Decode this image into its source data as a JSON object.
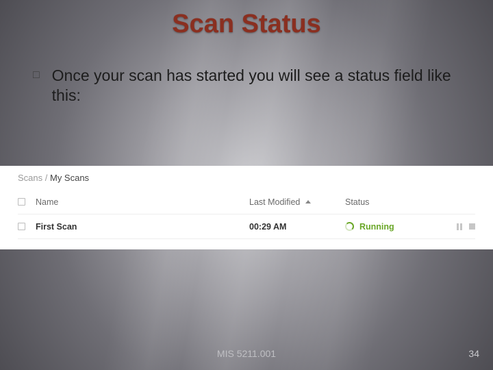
{
  "title": "Scan Status",
  "bullet": {
    "marker": "□",
    "text": "Once your scan has started you will see a status field like this:"
  },
  "panel": {
    "breadcrumb": {
      "root": "Scans",
      "sep": " / ",
      "current": "My Scans"
    },
    "headers": {
      "name": "Name",
      "last_modified": "Last Modified",
      "status": "Status"
    },
    "row": {
      "name": "First Scan",
      "last_modified": "00:29 AM",
      "status": "Running"
    }
  },
  "footer": {
    "course": "MIS 5211.001",
    "pagenum": "34"
  }
}
